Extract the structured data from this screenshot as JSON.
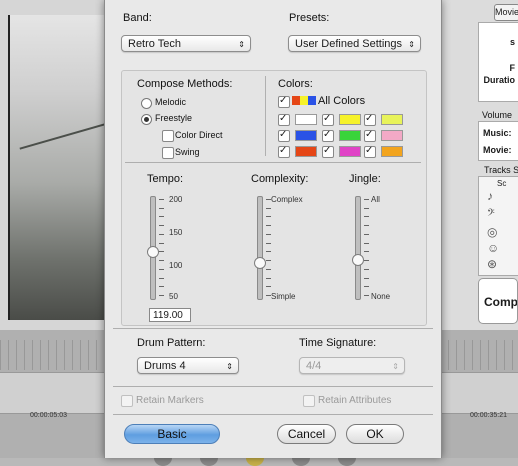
{
  "app": {
    "mode_tab": "Movie",
    "info_labels": [
      "s",
      "F",
      "Duratio"
    ],
    "volume_title": "Volume",
    "volume_labels": [
      "Music:",
      "Movie:"
    ],
    "tracks_title": "Tracks S",
    "tracks_sub": "Sc",
    "compose_label": "Compo",
    "timeline": {
      "time_left": "00:00:05:03",
      "time_right": "00:00:35:21"
    }
  },
  "dialog": {
    "band": {
      "label": "Band:",
      "value": "Retro Tech"
    },
    "presets": {
      "label": "Presets:",
      "value": "User Defined Settings"
    },
    "compose_methods": {
      "label": "Compose Methods:",
      "options": [
        "Melodic",
        "Freestyle"
      ],
      "selected": "Freestyle",
      "suboptions": [
        {
          "label": "Color Direct",
          "checked": false
        },
        {
          "label": "Swing",
          "checked": false
        }
      ]
    },
    "colors": {
      "label": "Colors:",
      "all_label": "All Colors",
      "all_checked": true,
      "swatches": [
        {
          "color": "#ffffff",
          "checked": true
        },
        {
          "color": "#f6f22a",
          "checked": true
        },
        {
          "color": "#e8f35a",
          "checked": true
        },
        {
          "color": "#2a52e6",
          "checked": true
        },
        {
          "color": "#39d43a",
          "checked": true
        },
        {
          "color": "#f3a9c6",
          "checked": true
        },
        {
          "color": "#e54616",
          "checked": true
        },
        {
          "color": "#e042c6",
          "checked": true
        },
        {
          "color": "#f2a41e",
          "checked": true
        }
      ]
    },
    "tempo": {
      "label": "Tempo:",
      "ticks": [
        "200",
        "150",
        "100",
        "50"
      ],
      "value": "119.00",
      "level": 0.46
    },
    "complexity": {
      "label": "Complexity:",
      "top": "Complex",
      "bottom": "Simple",
      "level": 0.35
    },
    "jingle": {
      "label": "Jingle:",
      "top": "All",
      "bottom": "None",
      "level": 0.38
    },
    "drum_pattern": {
      "label": "Drum Pattern:",
      "value": "Drums 4"
    },
    "time_signature": {
      "label": "Time Signature:",
      "value": "4/4",
      "enabled": false
    },
    "retain_markers": {
      "label": "Retain Markers",
      "checked": false,
      "enabled": false
    },
    "retain_attributes": {
      "label": "Retain Attributes",
      "checked": false,
      "enabled": false
    },
    "buttons": {
      "basic": "Basic",
      "cancel": "Cancel",
      "ok": "OK"
    }
  }
}
